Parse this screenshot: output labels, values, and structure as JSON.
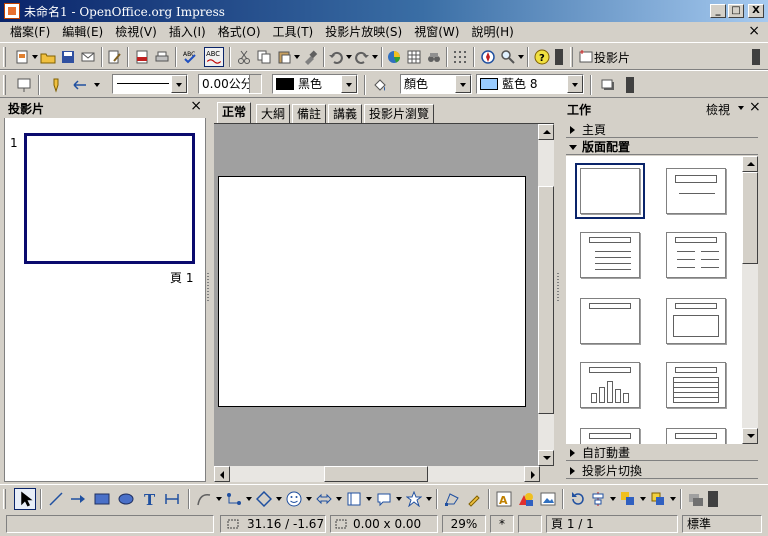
{
  "window": {
    "title": "未命名1 - OpenOffice.org Impress",
    "minimize": "_",
    "maximize": "□",
    "close": "X"
  },
  "menubar": {
    "items": [
      "檔案(F)",
      "編輯(E)",
      "檢視(V)",
      "插入(I)",
      "格式(O)",
      "工具(T)",
      "投影片放映(S)",
      "視窗(W)",
      "說明(H)"
    ],
    "close": "×"
  },
  "toolbar1": {
    "slides_button": "投影片"
  },
  "toolbar2": {
    "line_width": "0.00公分",
    "line_color": "黑色",
    "fill_type": "顏色",
    "fill_color": "藍色 8",
    "colors": {
      "line": "#000000",
      "fill": "#99ccff"
    }
  },
  "slides_panel": {
    "title": "投影片",
    "close": "×",
    "slide_number": "1",
    "page_label": "頁 1"
  },
  "view_tabs": [
    "正常",
    "大綱",
    "備註",
    "講義",
    "投影片瀏覽"
  ],
  "tasks_panel": {
    "title": "工作",
    "view_menu": "檢視",
    "close": "×",
    "sections": [
      "主頁",
      "版面配置",
      "自訂動畫",
      "投影片切換"
    ]
  },
  "statusbar": {
    "position": "31.16 / -1.67",
    "size": "0.00 x 0.00",
    "zoom": "29%",
    "modified": "*",
    "page": "頁 1 / 1",
    "style": "標準"
  }
}
